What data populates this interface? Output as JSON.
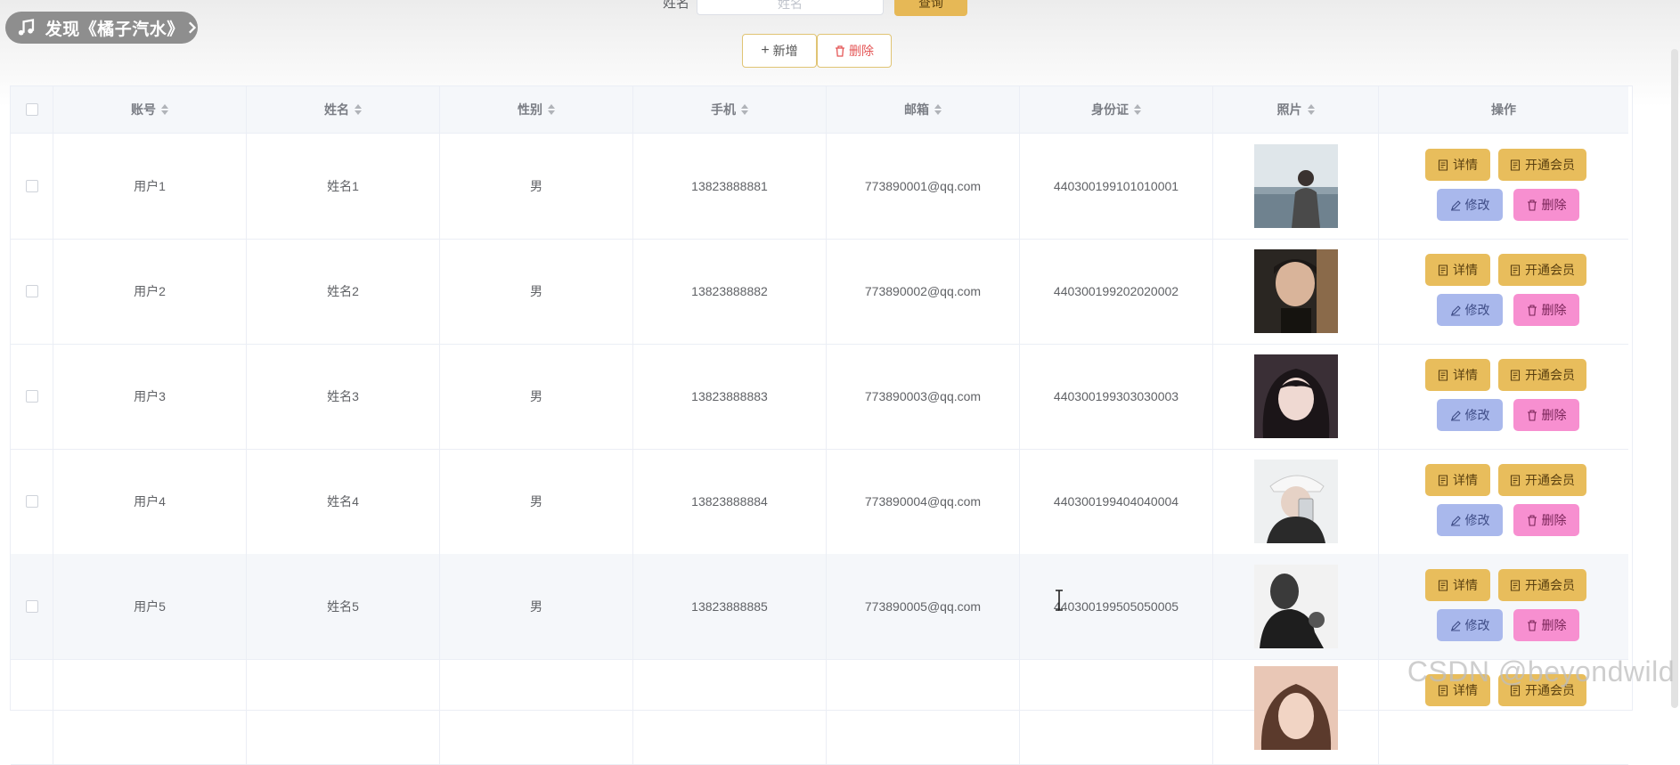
{
  "music_pill": {
    "text": "发现《橘子汽水》"
  },
  "search": {
    "label": "姓名",
    "placeholder": "姓名",
    "button_label": "查询"
  },
  "toolbar": {
    "add_label": "新增",
    "delete_label": "删除"
  },
  "table": {
    "columns": [
      "账号",
      "姓名",
      "性别",
      "手机",
      "邮箱",
      "身份证",
      "照片",
      "操作"
    ],
    "rows": [
      {
        "account": "用户1",
        "name": "姓名1",
        "gender": "男",
        "phone": "13823888881",
        "email": "773890001@qq.com",
        "id_card": "440300199101010001"
      },
      {
        "account": "用户2",
        "name": "姓名2",
        "gender": "男",
        "phone": "13823888882",
        "email": "773890002@qq.com",
        "id_card": "440300199202020002"
      },
      {
        "account": "用户3",
        "name": "姓名3",
        "gender": "男",
        "phone": "13823888883",
        "email": "773890003@qq.com",
        "id_card": "440300199303030003"
      },
      {
        "account": "用户4",
        "name": "姓名4",
        "gender": "男",
        "phone": "13823888884",
        "email": "773890004@qq.com",
        "id_card": "440300199404040004"
      },
      {
        "account": "用户5",
        "name": "姓名5",
        "gender": "男",
        "phone": "13823888885",
        "email": "773890005@qq.com",
        "id_card": "440300199505050005"
      },
      {
        "account": "",
        "name": "",
        "gender": "",
        "phone": "",
        "email": "",
        "id_card": ""
      }
    ],
    "actions": {
      "detail": "详情",
      "vip": "开通会员",
      "edit": "修改",
      "delete": "删除"
    }
  },
  "watermark": "CSDN @beyondwild",
  "colors": {
    "detail_btn": "#e8bd5c",
    "edit_btn": "#a9b8ec",
    "delete_btn": "#f78fd0",
    "header_bg": "#f5f7fa"
  }
}
